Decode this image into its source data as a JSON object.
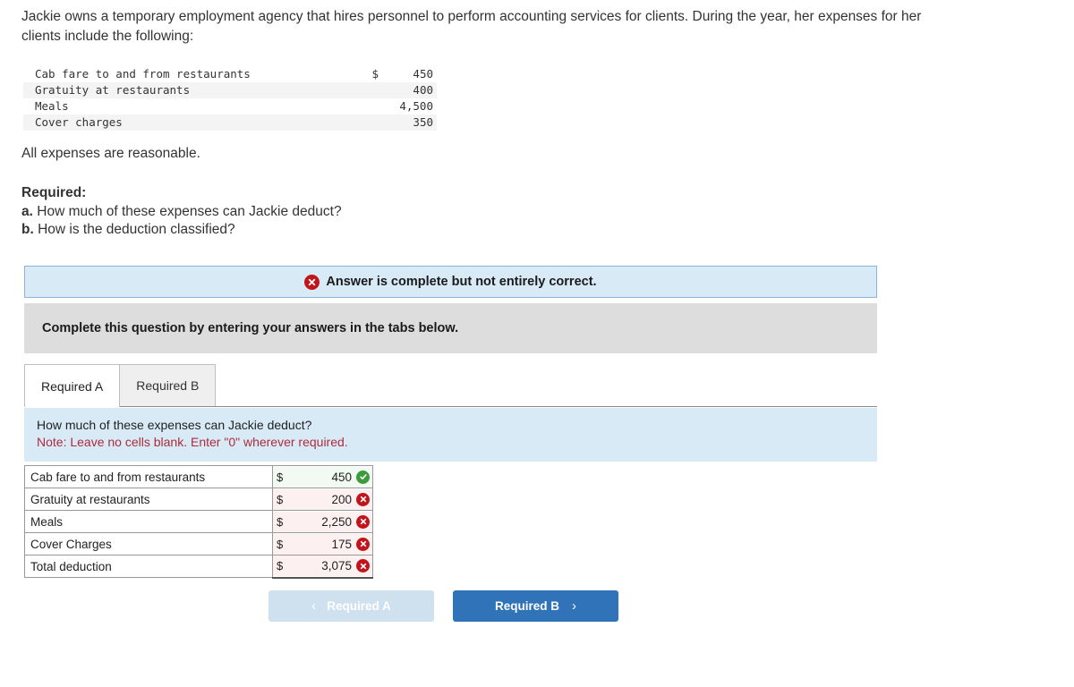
{
  "intro": {
    "paragraph": "Jackie owns a temporary employment agency that hires personnel to perform accounting services for clients. During the year, her expenses for her clients include the following:"
  },
  "given_table": {
    "rows": [
      {
        "label": "Cab fare to and from restaurants",
        "currency": "$",
        "amount": "450"
      },
      {
        "label": "Gratuity at restaurants",
        "currency": "",
        "amount": "400"
      },
      {
        "label": "Meals",
        "currency": "",
        "amount": "4,500"
      },
      {
        "label": "Cover charges",
        "currency": "",
        "amount": "350"
      }
    ]
  },
  "reasonable_note": "All expenses are reasonable.",
  "required": {
    "heading": "Required:",
    "item_a_marker": "a.",
    "item_a": "How much of these expenses can Jackie deduct?",
    "item_b_marker": "b.",
    "item_b": "How is the deduction classified?"
  },
  "alert": {
    "icon": "x-circle-icon",
    "text": "Answer is complete but not entirely correct."
  },
  "instruction": {
    "text": "Complete this question by entering your answers in the tabs below."
  },
  "tabs": [
    {
      "label": "Required A",
      "active": true
    },
    {
      "label": "Required B",
      "active": false
    }
  ],
  "question_panel": {
    "question": "How much of these expenses can Jackie deduct?",
    "note": "Note: Leave no cells blank. Enter \"0\" wherever required."
  },
  "answer_table": {
    "rows": [
      {
        "label": "Cab fare to and from restaurants",
        "currency": "$",
        "value": "450",
        "status": "correct"
      },
      {
        "label": "Gratuity at restaurants",
        "currency": "$",
        "value": "200",
        "status": "incorrect"
      },
      {
        "label": "Meals",
        "currency": "$",
        "value": "2,250",
        "status": "incorrect"
      },
      {
        "label": "Cover Charges",
        "currency": "$",
        "value": "175",
        "status": "incorrect"
      },
      {
        "label": "Total deduction",
        "currency": "$",
        "value": "3,075",
        "status": "incorrect"
      }
    ]
  },
  "nav": {
    "prev_label": "Required A",
    "prev_chevron": "‹",
    "next_label": "Required B",
    "next_chevron": "›"
  },
  "colors": {
    "accent_blue": "#3073b8",
    "panel_blue": "#d9eaf7",
    "gray_bar": "#dddddd",
    "correct_green": "#3c9b3c",
    "incorrect_red": "#c2151b",
    "note_red": "#ad2b3b"
  }
}
